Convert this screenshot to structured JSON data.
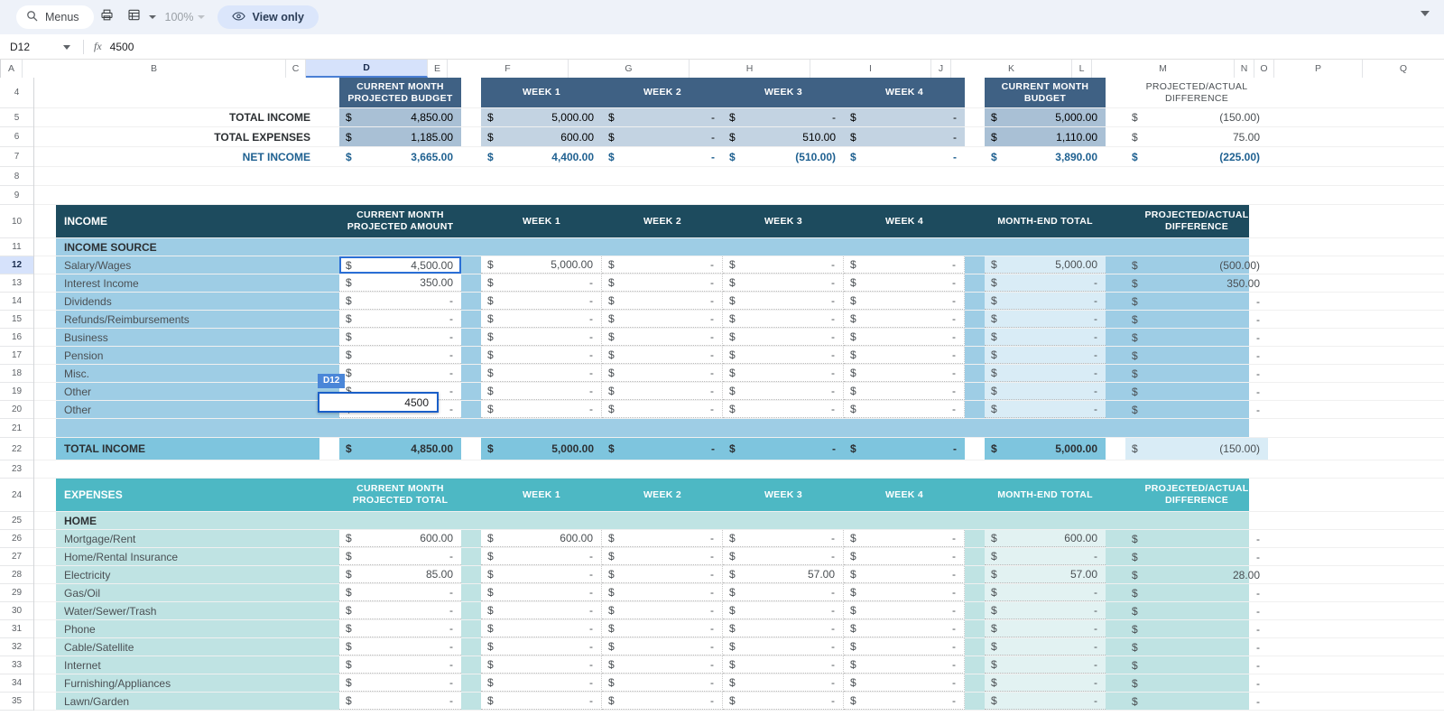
{
  "toolbar": {
    "menus_label": "Menus",
    "search_icon": "search-icon",
    "print_icon": "print-icon",
    "sheet_icon": "spreadsheet-icon",
    "zoom_level": "100%",
    "view_only_label": "View only",
    "eye_icon": "eye-icon"
  },
  "formula_bar": {
    "name_box": "D12",
    "fx_label": "fx",
    "value": "4500"
  },
  "grid": {
    "columns": [
      "A",
      "B",
      "C",
      "D",
      "E",
      "F",
      "G",
      "H",
      "I",
      "J",
      "K",
      "L",
      "M",
      "N",
      "O",
      "P",
      "Q"
    ],
    "selected_column": "D",
    "selected_row": "12",
    "rows": [
      "4",
      "5",
      "6",
      "7",
      "8",
      "9",
      "10",
      "11",
      "12",
      "13",
      "14",
      "15",
      "16",
      "17",
      "18",
      "19",
      "20",
      "21",
      "22",
      "23",
      "24",
      "25",
      "26",
      "27",
      "28",
      "29",
      "30",
      "31",
      "32",
      "33",
      "34"
    ]
  },
  "editing": {
    "cell_ref": "D12",
    "edit_value": "4500"
  },
  "summary": {
    "headers": {
      "d": "CURRENT MONTH\nPROJECTED BUDGET",
      "d_l1": "CURRENT MONTH",
      "d_l2": "PROJECTED BUDGET",
      "f": "WEEK 1",
      "g": "WEEK 2",
      "h": "WEEK 3",
      "i": "WEEK 4",
      "k_l1": "CURRENT MONTH",
      "k_l2": "BUDGET",
      "m_l1": "PROJECTED/ACTUAL",
      "m_l2": "DIFFERENCE"
    },
    "rows": [
      {
        "label": "TOTAL INCOME",
        "d": "4,850.00",
        "f": "5,000.00",
        "g": "-",
        "h": "-",
        "i": "-",
        "k": "5,000.00",
        "m": "(150.00)"
      },
      {
        "label": "TOTAL EXPENSES",
        "d": "1,185.00",
        "f": "600.00",
        "g": "-",
        "h": "510.00",
        "i": "-",
        "k": "1,110.00",
        "m": "75.00"
      },
      {
        "label": "NET INCOME",
        "d": "3,665.00",
        "f": "4,400.00",
        "g": "-",
        "h": "(510.00)",
        "i": "-",
        "k": "3,890.00",
        "m": "(225.00)"
      }
    ]
  },
  "income": {
    "section_title": "INCOME",
    "subheader": "INCOME SOURCE",
    "headers": {
      "d_l1": "CURRENT MONTH",
      "d_l2": "PROJECTED AMOUNT",
      "f": "WEEK 1",
      "g": "WEEK 2",
      "h": "WEEK 3",
      "i": "WEEK 4",
      "k": "MONTH-END TOTAL",
      "m_l1": "PROJECTED/ACTUAL",
      "m_l2": "DIFFERENCE"
    },
    "rows": [
      {
        "label": "Salary/Wages",
        "d": "4,500.00",
        "f": "5,000.00",
        "g": "-",
        "h": "-",
        "i": "-",
        "k": "5,000.00",
        "m": "(500.00)"
      },
      {
        "label": "Interest Income",
        "d": "350.00",
        "f": "-",
        "g": "-",
        "h": "-",
        "i": "-",
        "k": "-",
        "m": "350.00"
      },
      {
        "label": "Dividends",
        "d": "-",
        "f": "-",
        "g": "-",
        "h": "-",
        "i": "-",
        "k": "-",
        "m": "-"
      },
      {
        "label": "Refunds/Reimbursements",
        "d": "-",
        "f": "-",
        "g": "-",
        "h": "-",
        "i": "-",
        "k": "-",
        "m": "-"
      },
      {
        "label": "Business",
        "d": "-",
        "f": "-",
        "g": "-",
        "h": "-",
        "i": "-",
        "k": "-",
        "m": "-"
      },
      {
        "label": "Pension",
        "d": "-",
        "f": "-",
        "g": "-",
        "h": "-",
        "i": "-",
        "k": "-",
        "m": "-"
      },
      {
        "label": "Misc.",
        "d": "-",
        "f": "-",
        "g": "-",
        "h": "-",
        "i": "-",
        "k": "-",
        "m": "-"
      },
      {
        "label": "Other",
        "d": "-",
        "f": "-",
        "g": "-",
        "h": "-",
        "i": "-",
        "k": "-",
        "m": "-"
      },
      {
        "label": "Other",
        "d": "-",
        "f": "-",
        "g": "-",
        "h": "-",
        "i": "-",
        "k": "-",
        "m": "-"
      }
    ],
    "total": {
      "label": "TOTAL INCOME",
      "d": "4,850.00",
      "f": "5,000.00",
      "g": "-",
      "h": "-",
      "i": "-",
      "k": "5,000.00",
      "m": "(150.00)"
    }
  },
  "expenses": {
    "section_title": "EXPENSES",
    "subheader": "HOME",
    "headers": {
      "d_l1": "CURRENT MONTH",
      "d_l2": "PROJECTED TOTAL",
      "f": "WEEK 1",
      "g": "WEEK 2",
      "h": "WEEK 3",
      "i": "WEEK 4",
      "k": "MONTH-END TOTAL",
      "m_l1": "PROJECTED/ACTUAL",
      "m_l2": "DIFFERENCE"
    },
    "rows": [
      {
        "label": "Mortgage/Rent",
        "d": "600.00",
        "f": "600.00",
        "g": "-",
        "h": "-",
        "i": "-",
        "k": "600.00",
        "m": "-"
      },
      {
        "label": "Home/Rental Insurance",
        "d": "-",
        "f": "-",
        "g": "-",
        "h": "-",
        "i": "-",
        "k": "-",
        "m": "-"
      },
      {
        "label": "Electricity",
        "d": "85.00",
        "f": "-",
        "g": "-",
        "h": "57.00",
        "i": "-",
        "k": "57.00",
        "m": "28.00"
      },
      {
        "label": "Gas/Oil",
        "d": "-",
        "f": "-",
        "g": "-",
        "h": "-",
        "i": "-",
        "k": "-",
        "m": "-"
      },
      {
        "label": "Water/Sewer/Trash",
        "d": "-",
        "f": "-",
        "g": "-",
        "h": "-",
        "i": "-",
        "k": "-",
        "m": "-"
      },
      {
        "label": "Phone",
        "d": "-",
        "f": "-",
        "g": "-",
        "h": "-",
        "i": "-",
        "k": "-",
        "m": "-"
      },
      {
        "label": "Cable/Satellite",
        "d": "-",
        "f": "-",
        "g": "-",
        "h": "-",
        "i": "-",
        "k": "-",
        "m": "-"
      },
      {
        "label": "Internet",
        "d": "-",
        "f": "-",
        "g": "-",
        "h": "-",
        "i": "-",
        "k": "-",
        "m": "-"
      },
      {
        "label": "Furnishing/Appliances",
        "d": "-",
        "f": "-",
        "g": "-",
        "h": "-",
        "i": "-",
        "k": "-",
        "m": "-"
      },
      {
        "label": "Lawn/Garden",
        "d": "-",
        "f": "-",
        "g": "-",
        "h": "-",
        "i": "-",
        "k": "-",
        "m": "-"
      }
    ]
  },
  "colors": {
    "navy_header": "#3f6184",
    "dark_teal_header": "#1d4b5e",
    "teal_header": "#4db8c4",
    "sky_body": "#a7d4e8",
    "total_band": "#7ec5de",
    "accent_blue": "#1f6191",
    "selection": "#1a5fc8"
  }
}
